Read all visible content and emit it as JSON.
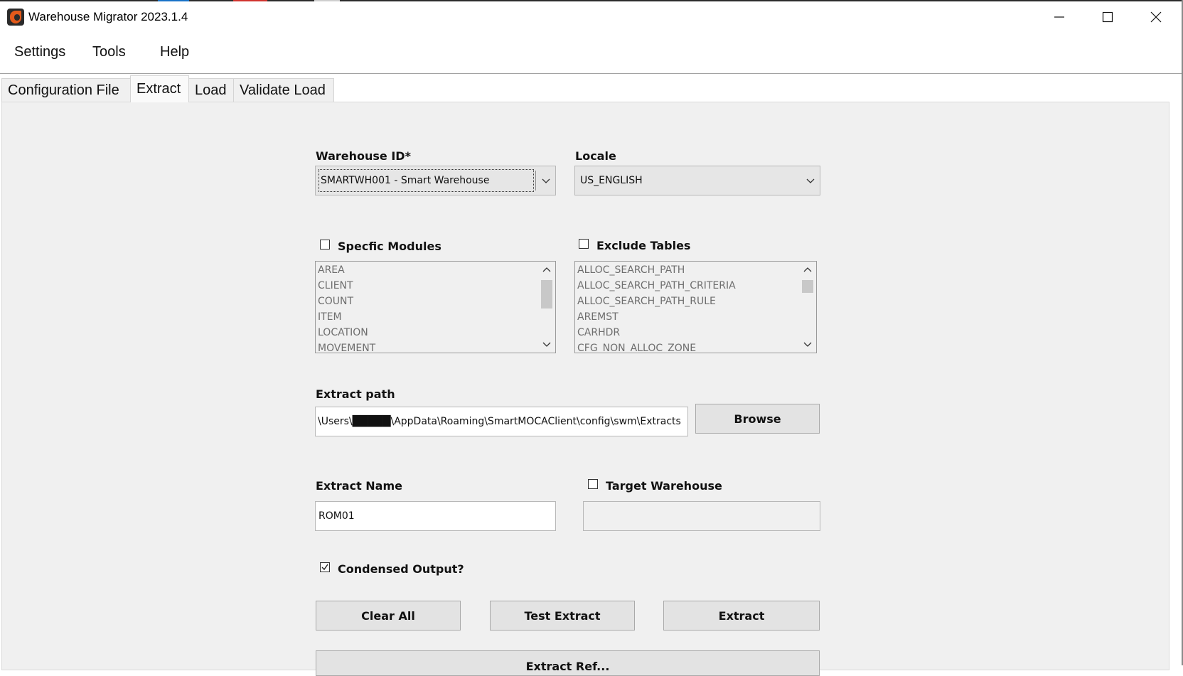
{
  "window": {
    "title": "Warehouse Migrator 2023.1.4",
    "icons": [
      "app-icon",
      "minimize-icon",
      "maximize-icon",
      "close-icon"
    ]
  },
  "menu": [
    "Settings",
    "Tools",
    "Help"
  ],
  "tabs": [
    {
      "label": "Configuration File",
      "active": false
    },
    {
      "label": "Extract",
      "active": true
    },
    {
      "label": "Load",
      "active": false
    },
    {
      "label": "Validate Load",
      "active": false
    }
  ],
  "form": {
    "warehouse_id": {
      "label": "Warehouse ID*",
      "value": "SMARTWH001 - Smart Warehouse"
    },
    "locale": {
      "label": "Locale",
      "value": "US_ENGLISH"
    },
    "specific_modules": {
      "label": "Specfic Modules",
      "checked": false,
      "items": [
        "AREA",
        "CLIENT",
        "COUNT",
        "ITEM",
        "LOCATION",
        "MOVEMENT"
      ]
    },
    "exclude_tables": {
      "label": "Exclude Tables",
      "checked": false,
      "items": [
        "ALLOC_SEARCH_PATH",
        "ALLOC_SEARCH_PATH_CRITERIA",
        "ALLOC_SEARCH_PATH_RULE",
        "AREMST",
        "CARHDR",
        "CFG_NON_ALLOC_ZONE"
      ]
    },
    "extract_path": {
      "label": "Extract path",
      "value": "\\Users\\█████\\AppData\\Roaming\\SmartMOCAClient\\config\\swm\\Extracts",
      "browse_label": "Browse"
    },
    "extract_name": {
      "label": "Extract Name",
      "value": "ROM01"
    },
    "target_warehouse": {
      "label": "Target Warehouse",
      "checked": false,
      "value": ""
    },
    "condensed_output": {
      "label": "Condensed Output?",
      "checked": true
    }
  },
  "buttons": {
    "clear_all": "Clear All",
    "test_extract": "Test Extract",
    "extract": "Extract",
    "extract_partial": "Extract Ref..."
  },
  "colors": {
    "accent_icon": "#e35a1b",
    "panel_bg": "#f0f0f0",
    "button_bg": "#e3e3e3"
  }
}
